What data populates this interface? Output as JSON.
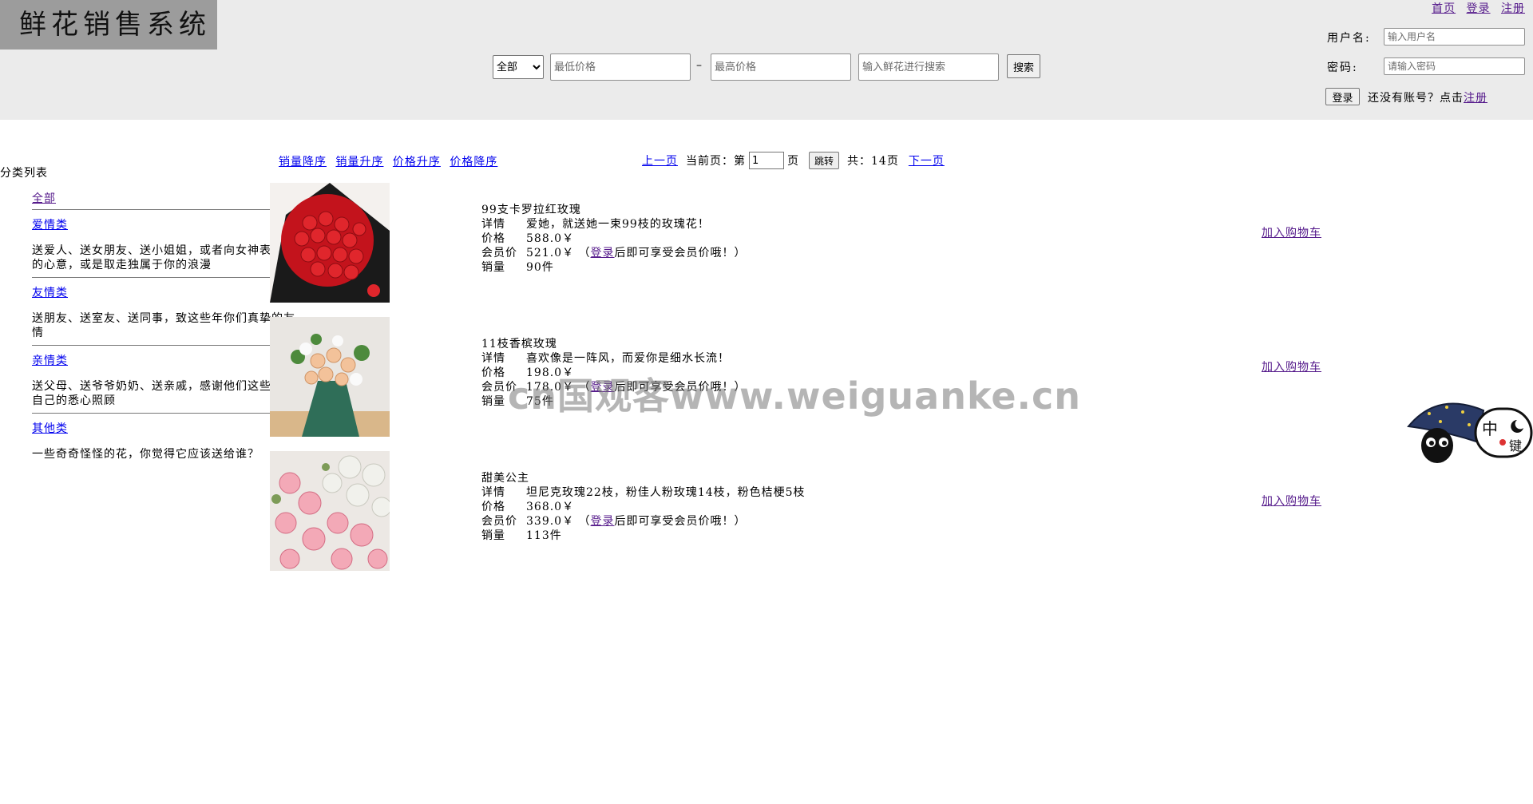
{
  "header": {
    "logo": "鲜花销售系统",
    "links": [
      "首页",
      "登录",
      "注册"
    ],
    "search": {
      "category_options": [
        "全部"
      ],
      "category_selected": "全部",
      "min_price_placeholder": "最低价格",
      "dash": "–",
      "max_price_placeholder": "最高价格",
      "keyword_placeholder": "输入鲜花进行搜索",
      "search_button": "搜索"
    },
    "login": {
      "username_label": "用户名:",
      "username_placeholder": "输入用户名",
      "password_label": "密码:",
      "password_placeholder": "请输入密码",
      "login_button": "登录",
      "register_hint": "还没有账号？点击",
      "register_link": "注册"
    }
  },
  "sort": {
    "options": [
      "销量降序",
      "销量升序",
      "价格升序",
      "价格降序"
    ]
  },
  "pagination": {
    "prev": "上一页",
    "current_label": "当前页：第",
    "current_page": "1",
    "page_suffix": "页",
    "jump_button": "跳转",
    "total_label": "共：14页",
    "next": "下一页"
  },
  "categories": {
    "title": "分类列表",
    "items": [
      {
        "name": "全部",
        "desc": ""
      },
      {
        "name": "爱情类",
        "desc": "送爱人、送女朋友、送小姐姐，或者向女神表明你的心意，或是取走独属于你的浪漫"
      },
      {
        "name": "友情类",
        "desc": "送朋友、送室友、送同事，致这些年你们真挚的友情"
      },
      {
        "name": "亲情类",
        "desc": "送父母、送爷爷奶奶、送亲戚，感谢他们这些年对自己的悉心照顾"
      },
      {
        "name": "其他类",
        "desc": "一些奇奇怪怪的花，你觉得它应该送给谁？"
      }
    ]
  },
  "labels": {
    "detail": "详情",
    "price": "价格",
    "member_price": "会员价",
    "sales": "销量",
    "login_link": "登录",
    "member_note_suffix": "后即可享受会员价哦！）",
    "member_note_prefix": "（",
    "add_cart": "加入购物车"
  },
  "products": [
    {
      "name": "99支卡罗拉红玫瑰",
      "detail": "爱她，就送她一束99枝的玫瑰花！",
      "price": "588.0￥",
      "member_price": "521.0￥",
      "sales": "90件"
    },
    {
      "name": "11枝香槟玫瑰",
      "detail": "喜欢像是一阵风，而爱你是细水长流！",
      "price": "198.0￥",
      "member_price": "178.0￥",
      "sales": "75件"
    },
    {
      "name": "甜美公主",
      "detail": "坦尼克玫瑰22枝，粉佳人粉玫瑰14枝，粉色桔梗5枝",
      "price": "368.0￥",
      "member_price": "339.0￥",
      "sales": "113件"
    }
  ],
  "watermark": "cn国观客www.weiguanke.cn",
  "mascot": {
    "text_top": "中",
    "text_side": "键",
    "icon": "umbrella-cat-icon"
  },
  "colors": {
    "header_bg": "#ebebeb",
    "logo_bg": "#9c9c9c",
    "link": "#0000ee",
    "visited": "#551a8b"
  }
}
